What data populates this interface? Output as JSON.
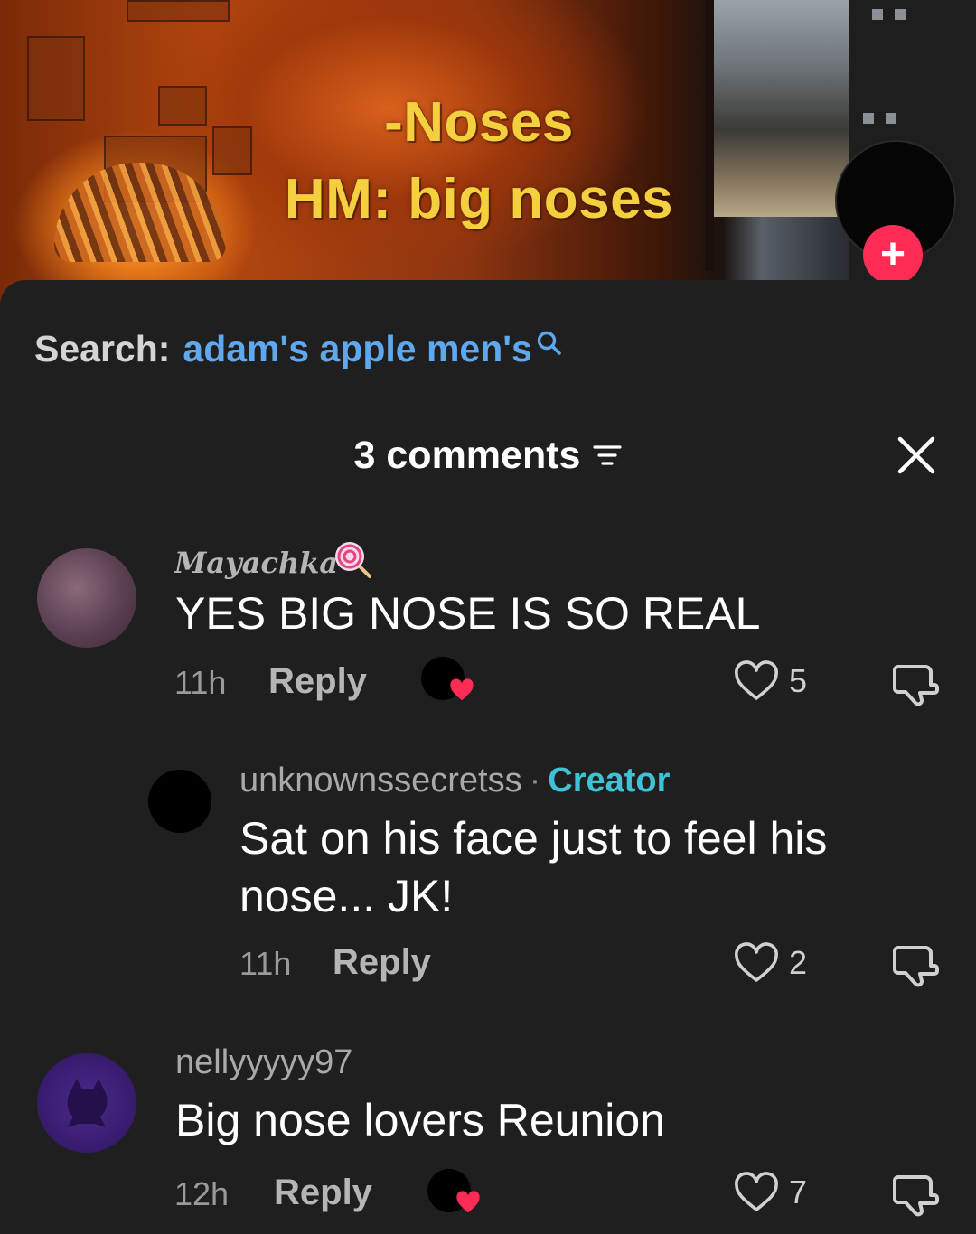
{
  "video": {
    "overlay_line1": "-Noses",
    "overlay_line2": "HM: big noses",
    "follow_symbol": "+"
  },
  "search": {
    "label": "Search:",
    "query": "adam's apple men's"
  },
  "comments_header": {
    "title": "3 comments",
    "close_symbol": "✕"
  },
  "comments": [
    {
      "username": "Mayachka",
      "username_emoji": "lollipop-icon",
      "text": "YES BIG NOSE IS SO REAL",
      "time": "11h",
      "reply_label": "Reply",
      "creator_liked": true,
      "likes": "5"
    },
    {
      "username": "unknownssecretss",
      "badge": "Creator",
      "separator": "·",
      "text": "Sat on his face just to feel his nose... JK!",
      "time": "11h",
      "reply_label": "Reply",
      "creator_liked": false,
      "likes": "2"
    },
    {
      "username": "nellyyyyy97",
      "text": "Big nose lovers Reunion",
      "time": "12h",
      "reply_label": "Reply",
      "creator_liked": true,
      "likes": "7"
    }
  ],
  "colors": {
    "overlay_text": "#f4d03f",
    "search_query": "#5fa8ee",
    "creator_badge": "#3ec3d6",
    "follow_button": "#fe2c55",
    "liked_heart": "#fe2c55",
    "sheet_background": "#1f1f1f"
  }
}
